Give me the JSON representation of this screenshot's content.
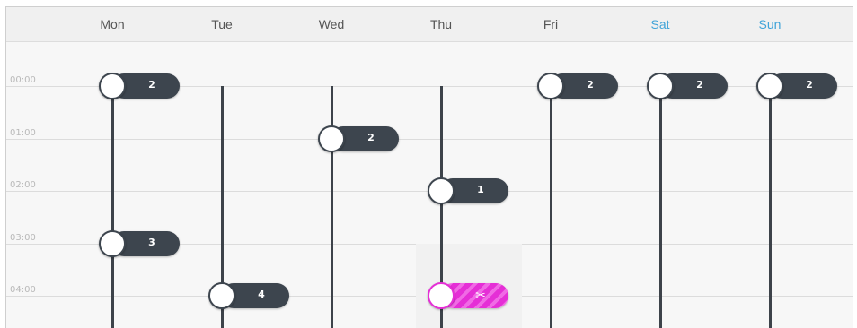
{
  "days": [
    {
      "label": "Mon",
      "weekend": false
    },
    {
      "label": "Tue",
      "weekend": false
    },
    {
      "label": "Wed",
      "weekend": false
    },
    {
      "label": "Thu",
      "weekend": false
    },
    {
      "label": "Fri",
      "weekend": false
    },
    {
      "label": "Sat",
      "weekend": true
    },
    {
      "label": "Sun",
      "weekend": true
    }
  ],
  "hours": [
    "00:00",
    "01:00",
    "02:00",
    "03:00",
    "04:00"
  ],
  "events": [
    {
      "day": "Mon",
      "time": "00:00",
      "count": "2",
      "active": false
    },
    {
      "day": "Mon",
      "time": "03:00",
      "count": "3",
      "active": false
    },
    {
      "day": "Tue",
      "time": "04:00",
      "count": "4",
      "active": false
    },
    {
      "day": "Wed",
      "time": "01:00",
      "count": "2",
      "active": false
    },
    {
      "day": "Thu",
      "time": "02:00",
      "count": "1",
      "active": false
    },
    {
      "day": "Thu",
      "time": "04:00",
      "count": "✂",
      "active": true
    },
    {
      "day": "Fri",
      "time": "00:00",
      "count": "2",
      "active": false
    },
    {
      "day": "Sat",
      "time": "00:00",
      "count": "2",
      "active": false
    },
    {
      "day": "Sun",
      "time": "00:00",
      "count": "2",
      "active": false
    }
  ],
  "colors": {
    "node": "#3d454e",
    "active": "#e52fd6",
    "weekend_label": "#3fa3d8",
    "gridline": "#dcdcdc"
  }
}
